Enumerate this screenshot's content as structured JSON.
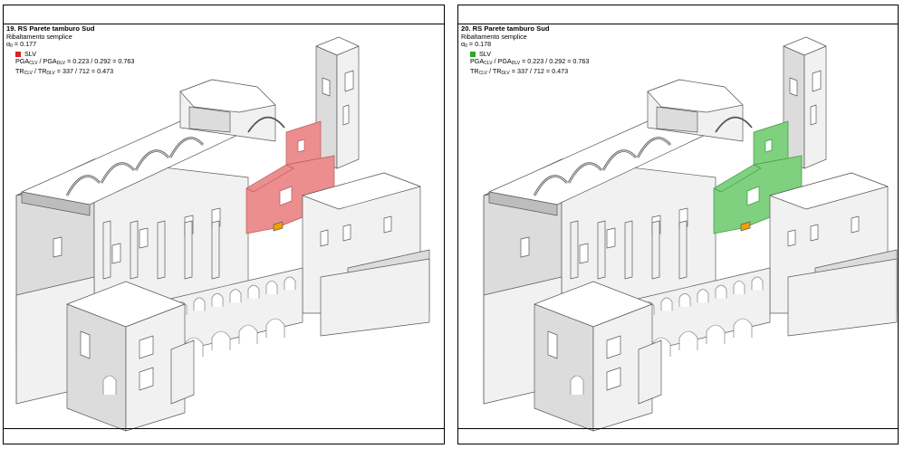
{
  "panels": [
    {
      "title": "19. RS Parete tamburo Sud",
      "mechanism": "Ribaltamento semplice",
      "alpha_symbol": "α",
      "alpha_sub": "0",
      "alpha_value": " = 0.177",
      "state_label": "SLV",
      "state_color": "#e02020",
      "pga_pre": "PGA",
      "pga_sub1": "CLV",
      "pga_mid": " / PGA",
      "pga_sub2": "DLV",
      "pga_value": " = 0.223 / 0.292 = 0.763",
      "tr_pre": "TR",
      "tr_sub1": "CLV",
      "tr_mid": " / TR",
      "tr_sub2": "DLV",
      "tr_value": " = 337 / 712 = 0.473",
      "highlight_fill": "#ec8e8e",
      "highlight_stroke": "#b85a5a"
    },
    {
      "title": "20. RS Parete tamburo Sud",
      "mechanism": "Ribaltamento semplice",
      "alpha_symbol": "α",
      "alpha_sub": "0",
      "alpha_value": " = 0.178",
      "state_label": "SLV",
      "state_color": "#2ca82c",
      "pga_pre": "PGA",
      "pga_sub1": "CLV",
      "pga_mid": " / PGA",
      "pga_sub2": "DLV",
      "pga_value": " = 0.223 / 0.292 = 0.763",
      "tr_pre": "TR",
      "tr_sub1": "CLV",
      "tr_mid": " / TR",
      "tr_sub2": "DLV",
      "tr_value": " = 337 / 712 = 0.473",
      "highlight_fill": "#7fd07f",
      "highlight_stroke": "#3f9a3f"
    }
  ]
}
